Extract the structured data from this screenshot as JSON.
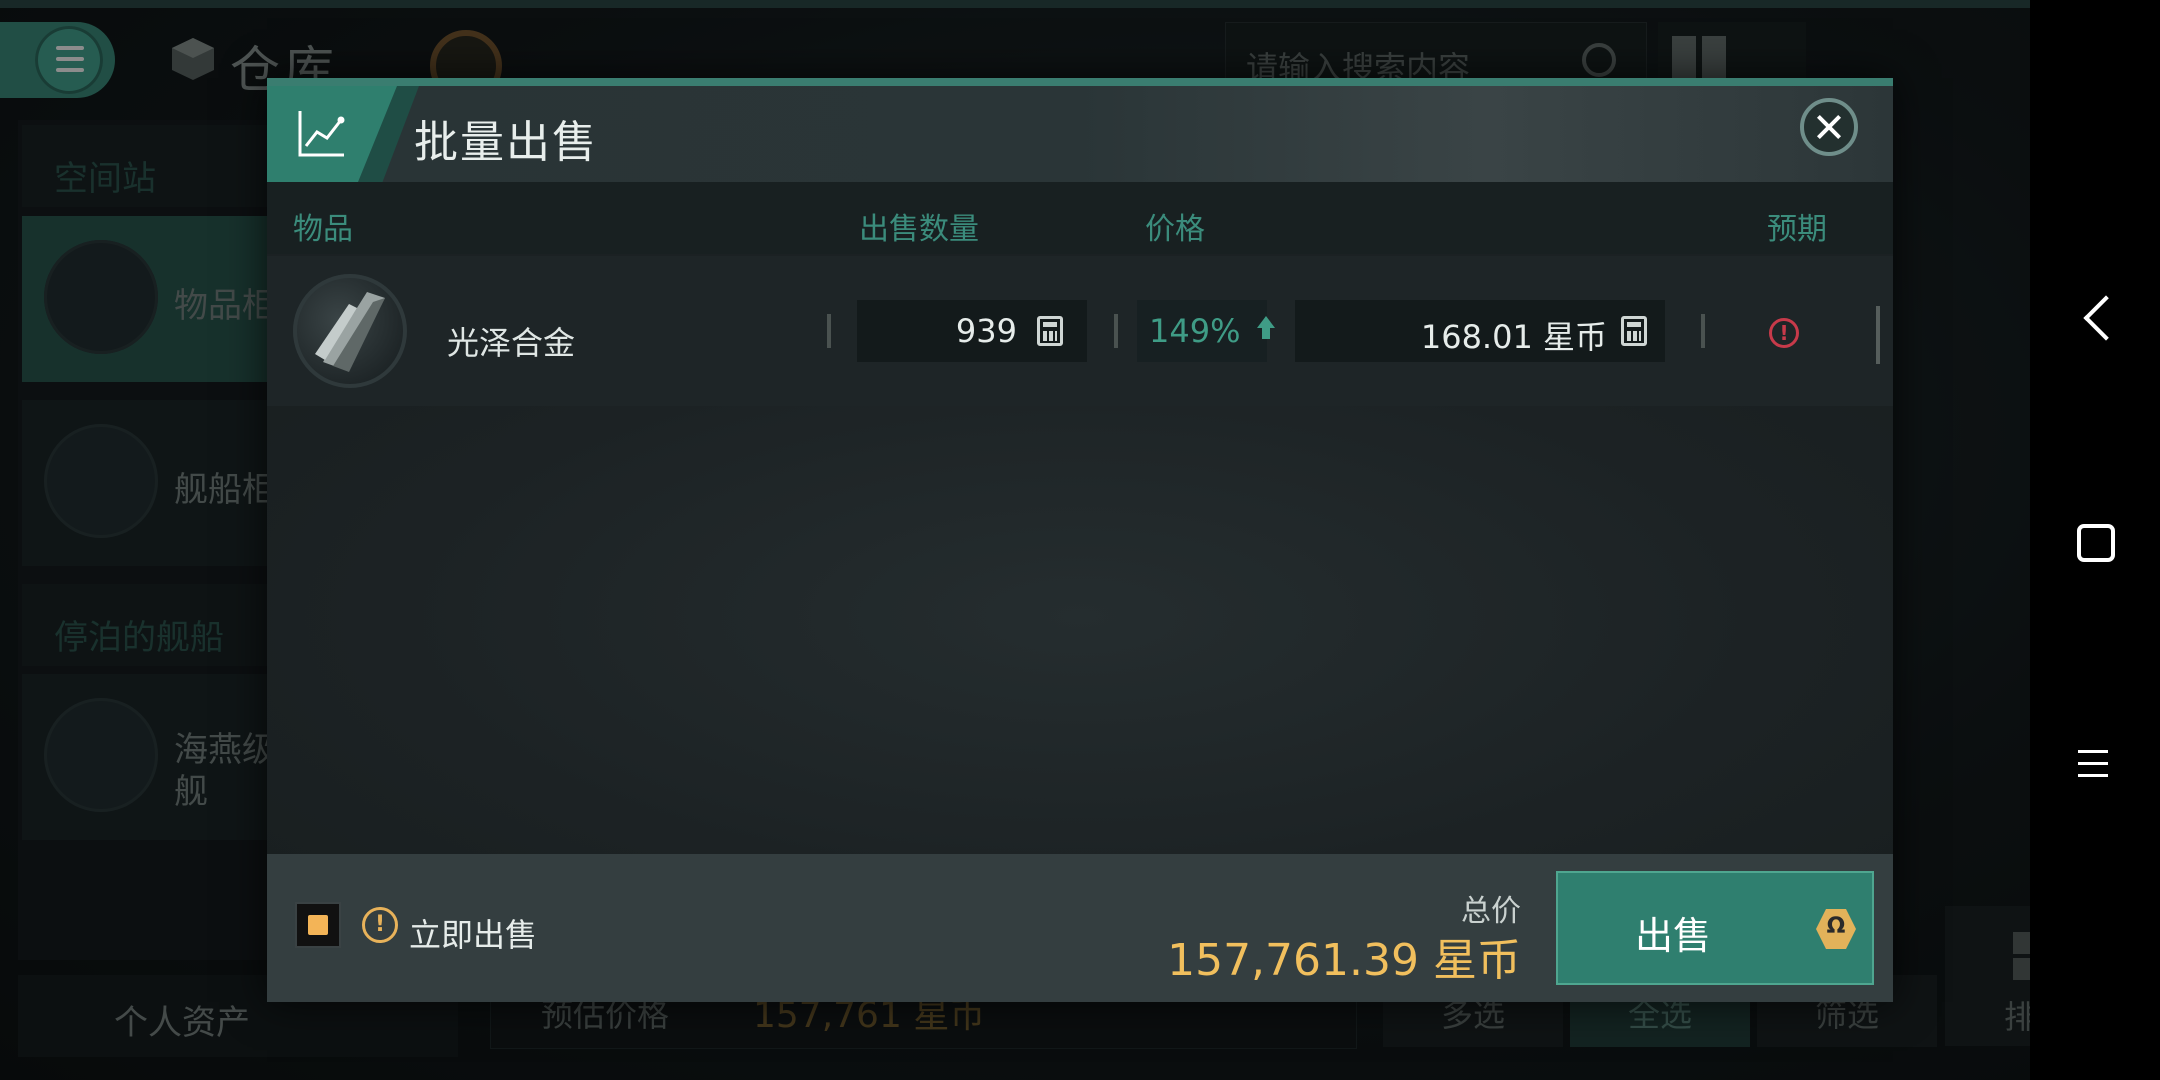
{
  "background": {
    "title": "仓库",
    "search_placeholder": "请输入搜索内容",
    "sidebar": {
      "section_station": "空间站",
      "item_goods": "物品柜",
      "item_ships": "舰船柜",
      "section_docked": "停泊的舰船",
      "docked_ship_line1": "海燕级",
      "docked_ship_line2": "舰"
    },
    "personal_assets": "个人资产",
    "estimate_label": "预估价格",
    "estimate_value": "157,761 星币",
    "buttons": {
      "multi_select": "多选",
      "select_all": "全选",
      "filter": "筛选",
      "sort": "排序"
    }
  },
  "modal": {
    "title": "批量出售",
    "columns": {
      "item": "物品",
      "quantity": "出售数量",
      "price": "价格",
      "expect": "预期"
    },
    "rows": [
      {
        "name": "光泽合金",
        "quantity": "939",
        "percent": "149%",
        "price": "168.01 星币"
      }
    ],
    "footer": {
      "instant_sell_label": "立即出售",
      "instant_sell_checked": true,
      "total_label": "总价",
      "total_value": "157,761.39 星币",
      "sell_button": "出售",
      "sell_badge": "Ω"
    }
  },
  "colors": {
    "accent_teal": "#2f7f6f",
    "gold": "#f1bf5d",
    "positive_green": "#3f9c86",
    "warning_red": "#c73a4a"
  }
}
